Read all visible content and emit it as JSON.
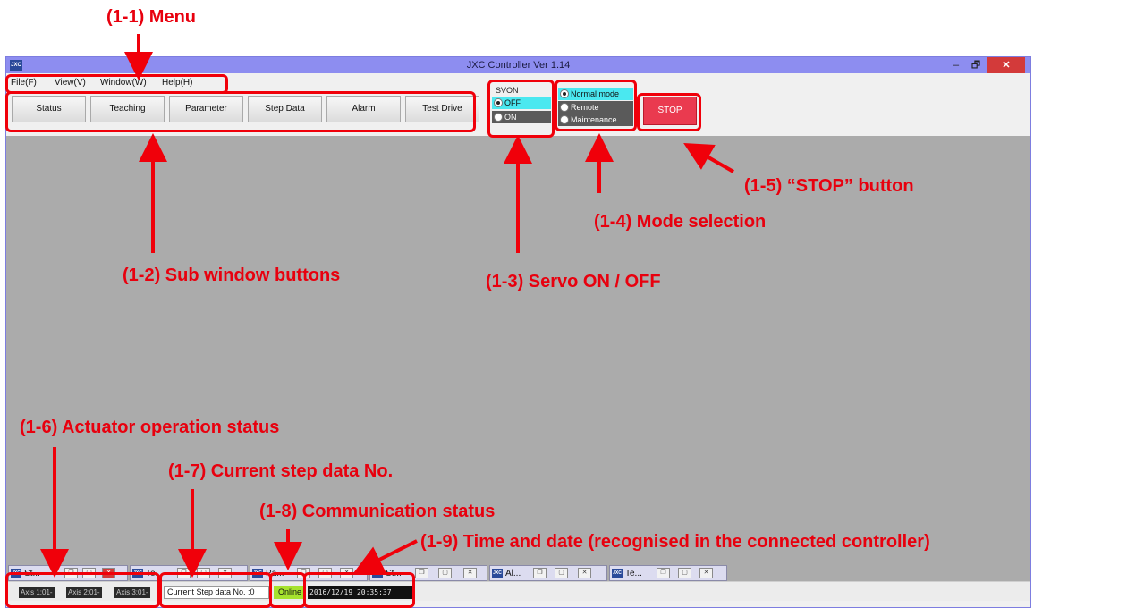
{
  "window": {
    "app_icon": "JXC",
    "title": "JXC Controller Ver 1.14",
    "min_label": "–",
    "max_label": "🗗",
    "close_label": "✕"
  },
  "menu": [
    {
      "label": "File(F)"
    },
    {
      "label": "View(V)"
    },
    {
      "label": "Window(W)"
    },
    {
      "label": "Help(H)"
    }
  ],
  "sub_buttons": [
    "Status",
    "Teaching",
    "Parameter",
    "Step Data",
    "Alarm",
    "Test Drive"
  ],
  "svon": {
    "label": "SVON",
    "options": [
      {
        "label": "OFF",
        "selected": true
      },
      {
        "label": "ON",
        "selected": false
      }
    ]
  },
  "modes": [
    {
      "label": "Normal mode",
      "selected": true
    },
    {
      "label": "Remote",
      "selected": false
    },
    {
      "label": "Maintenance",
      "selected": false
    }
  ],
  "stop_label": "STOP",
  "minimized": [
    {
      "label": "St..."
    },
    {
      "label": "Te..."
    },
    {
      "label": "Pa..."
    },
    {
      "label": "St..."
    },
    {
      "label": "Al..."
    },
    {
      "label": "Te..."
    }
  ],
  "status": {
    "axes": [
      "Axis 1:01-",
      "Axis 2:01-",
      "Axis 3:01-"
    ],
    "current_step": "Current Step data No. :0",
    "comm": "Online",
    "datetime": "2016/12/19 20:35:37"
  },
  "annotations": {
    "menu": "(1-1) Menu",
    "sub_window": "(1-2) Sub window buttons",
    "servo": "(1-3) Servo ON / OFF",
    "mode": "(1-4) Mode selection",
    "stop": "(1-5) “STOP” button",
    "actuator": "(1-6) Actuator operation status",
    "step": "(1-7) Current step data No.",
    "comm": "(1-8) Communication status",
    "time": "(1-9) Time and date (recognised in the connected controller)"
  },
  "colors": {
    "annotation": "#f0000a",
    "titlebar": "#8d8df0",
    "workspace": "#ababab",
    "selected_radio": "#4ae8f0",
    "unselected_radio": "#5a5a5a",
    "stop": "#ea3a4f",
    "online": "#a6e22e"
  }
}
